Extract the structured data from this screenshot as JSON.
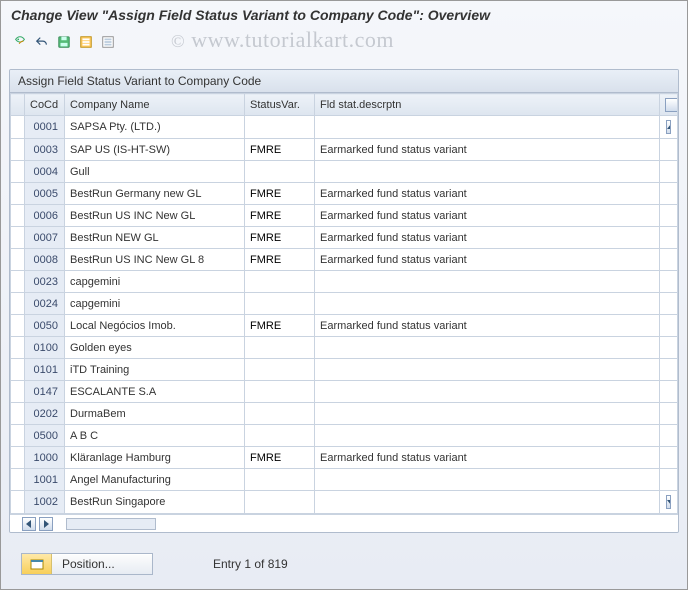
{
  "title": "Change View \"Assign Field Status Variant to Company Code\": Overview",
  "watermark": "www.tutorialkart.com",
  "toolbar": {
    "btns": [
      "otherview-icon",
      "undo-icon",
      "save-icon",
      "select-all-icon",
      "deselect-all-icon"
    ]
  },
  "panel": {
    "title": "Assign Field Status Variant to Company Code"
  },
  "columns": {
    "cocd": "CoCd",
    "name": "Company Name",
    "statusvar": "StatusVar.",
    "desc": "Fld stat.descrptn"
  },
  "rows": [
    {
      "cocd": "0001",
      "name": "SAPSA Pty. (LTD.)",
      "sv": "",
      "desc": ""
    },
    {
      "cocd": "0003",
      "name": "SAP US (IS-HT-SW)",
      "sv": "FMRE",
      "desc": "Earmarked fund status variant"
    },
    {
      "cocd": "0004",
      "name": "Gull",
      "sv": "",
      "desc": ""
    },
    {
      "cocd": "0005",
      "name": "BestRun Germany new GL",
      "sv": "FMRE",
      "desc": "Earmarked fund status variant"
    },
    {
      "cocd": "0006",
      "name": "BestRun US INC New GL",
      "sv": "FMRE",
      "desc": "Earmarked fund status variant"
    },
    {
      "cocd": "0007",
      "name": "BestRun NEW GL",
      "sv": "FMRE",
      "desc": "Earmarked fund status variant"
    },
    {
      "cocd": "0008",
      "name": "BestRun US INC New GL 8",
      "sv": "FMRE",
      "desc": "Earmarked fund status variant"
    },
    {
      "cocd": "0023",
      "name": "capgemini",
      "sv": "",
      "desc": ""
    },
    {
      "cocd": "0024",
      "name": "capgemini",
      "sv": "",
      "desc": ""
    },
    {
      "cocd": "0050",
      "name": "Local Negócios Imob.",
      "sv": "FMRE",
      "desc": "Earmarked fund status variant"
    },
    {
      "cocd": "0100",
      "name": "Golden eyes",
      "sv": "",
      "desc": ""
    },
    {
      "cocd": "0101",
      "name": "iTD Training",
      "sv": "",
      "desc": ""
    },
    {
      "cocd": "0147",
      "name": "ESCALANTE S.A",
      "sv": "",
      "desc": ""
    },
    {
      "cocd": "0202",
      "name": "DurmaBem",
      "sv": "",
      "desc": ""
    },
    {
      "cocd": "0500",
      "name": "A B C",
      "sv": "",
      "desc": ""
    },
    {
      "cocd": "1000",
      "name": "Kläranlage Hamburg",
      "sv": "FMRE",
      "desc": "Earmarked fund status variant"
    },
    {
      "cocd": "1001",
      "name": "Angel Manufacturing",
      "sv": "",
      "desc": ""
    },
    {
      "cocd": "1002",
      "name": "BestRun Singapore",
      "sv": "",
      "desc": ""
    }
  ],
  "footer": {
    "position_btn": "Position...",
    "entry_label": "Entry 1 of 819"
  }
}
